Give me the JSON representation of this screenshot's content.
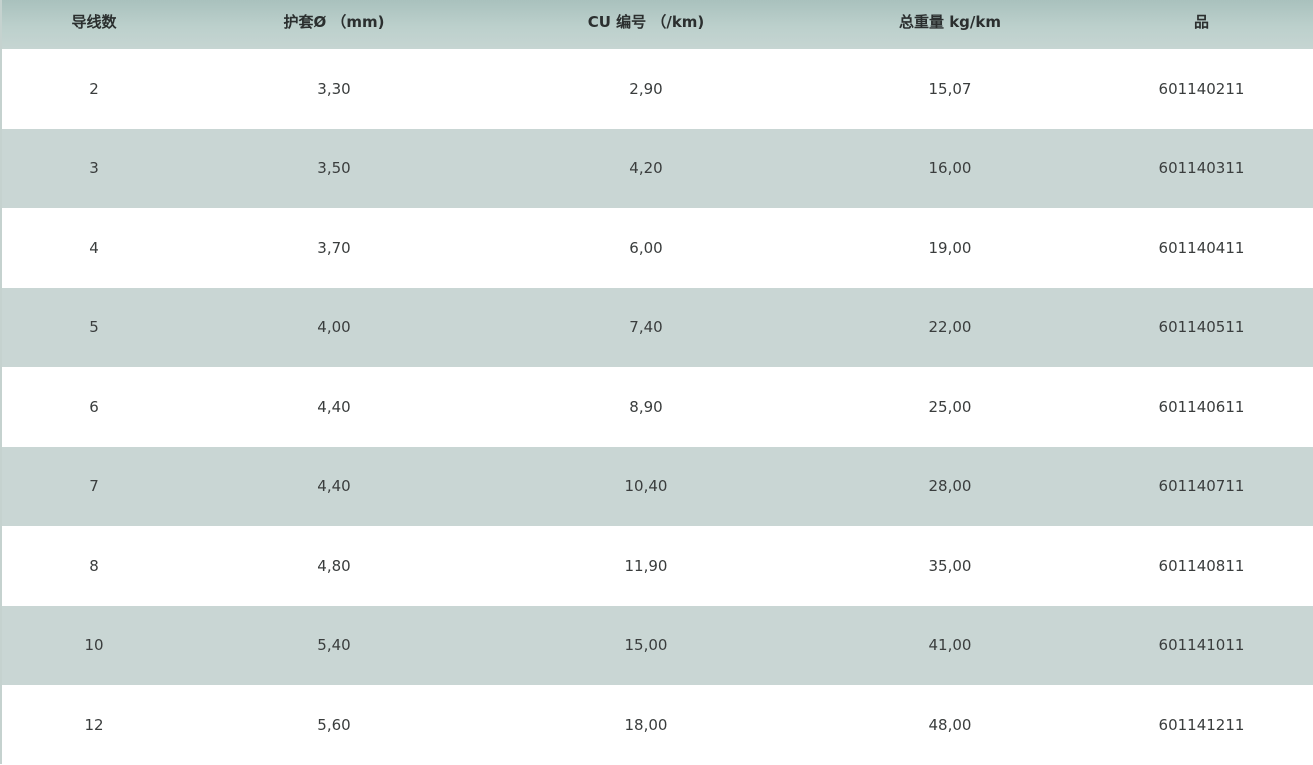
{
  "table": {
    "headers": [
      "导线数",
      "护套Ø （mm)",
      "CU 编号 （/km)",
      "总重量 kg/km",
      "品"
    ],
    "rows": [
      [
        "2",
        "3,30",
        "2,90",
        "15,07",
        "601140211"
      ],
      [
        "3",
        "3,50",
        "4,20",
        "16,00",
        "601140311"
      ],
      [
        "4",
        "3,70",
        "6,00",
        "19,00",
        "601140411"
      ],
      [
        "5",
        "4,00",
        "7,40",
        "22,00",
        "601140511"
      ],
      [
        "6",
        "4,40",
        "8,90",
        "25,00",
        "601140611"
      ],
      [
        "7",
        "4,40",
        "10,40",
        "28,00",
        "601140711"
      ],
      [
        "8",
        "4,80",
        "11,90",
        "35,00",
        "601140811"
      ],
      [
        "10",
        "5,40",
        "15,00",
        "41,00",
        "601141011"
      ],
      [
        "12",
        "5,60",
        "18,00",
        "48,00",
        "601141211"
      ]
    ]
  },
  "colors": {
    "header_bg": "#b8ccc8",
    "row_alt_bg": "#c9d6d4",
    "row_bg": "#ffffff",
    "text": "#3a3d3d"
  }
}
